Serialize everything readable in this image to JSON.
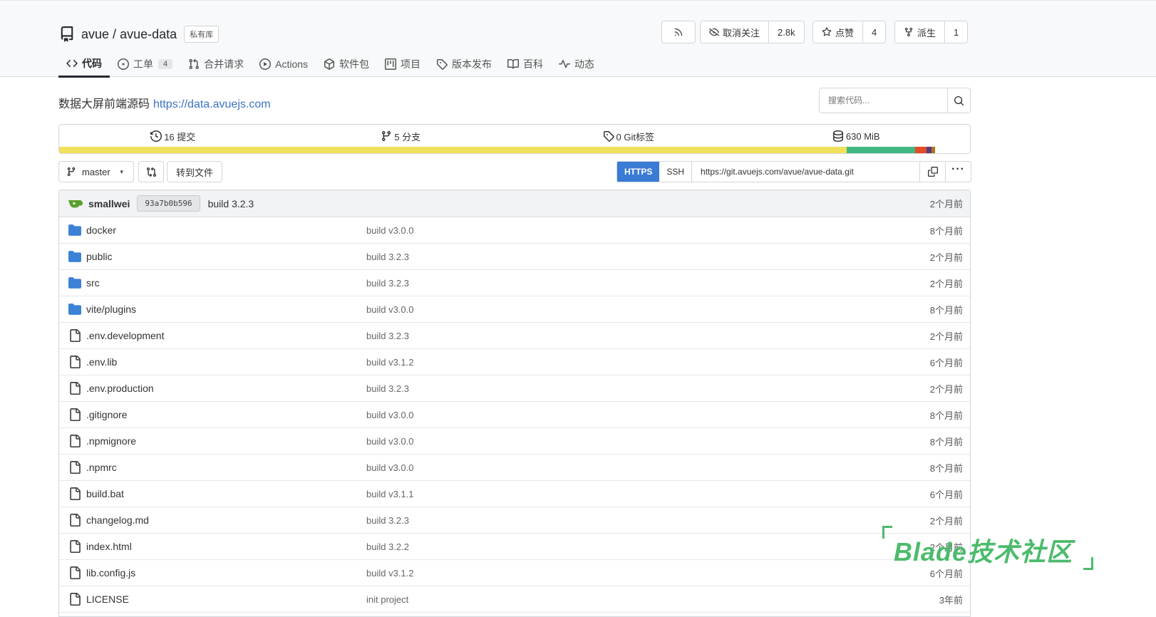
{
  "repo": {
    "owner": "avue",
    "separator": "/",
    "name": "avue-data",
    "visibility_badge": "私有库"
  },
  "actions": {
    "rss_icon": "rss-icon",
    "watch_label": "取消关注",
    "watch_count": "2.8k",
    "star_label": "点赞",
    "star_count": "4",
    "fork_label": "派生",
    "fork_count": "1"
  },
  "tabs": [
    {
      "label": "代码",
      "icon": "code-icon",
      "active": true
    },
    {
      "label": "工单",
      "icon": "issue-icon",
      "count": "4"
    },
    {
      "label": "合并请求",
      "icon": "pull-request-icon"
    },
    {
      "label": "Actions",
      "icon": "play-icon"
    },
    {
      "label": "软件包",
      "icon": "package-icon"
    },
    {
      "label": "项目",
      "icon": "project-icon"
    },
    {
      "label": "版本发布",
      "icon": "tag-icon"
    },
    {
      "label": "百科",
      "icon": "book-icon"
    },
    {
      "label": "动态",
      "icon": "pulse-icon"
    }
  ],
  "description": {
    "text": "数据大屏前端源码",
    "link": "https://data.avuejs.com"
  },
  "search": {
    "placeholder": "搜索代码..."
  },
  "stats": [
    {
      "label": "16 提交",
      "icon": "history-icon"
    },
    {
      "label": "5 分支",
      "icon": "branch-icon"
    },
    {
      "label": "0 Git标签",
      "icon": "tag-icon"
    },
    {
      "label": "630 MiB",
      "icon": "database-icon"
    }
  ],
  "language_colors": [
    "#f1e05a",
    "#41b883",
    "#e34c26",
    "#563d7c",
    "#b07219"
  ],
  "toolbar": {
    "branch": "master",
    "goto_file": "转到文件",
    "protocol_https": "HTTPS",
    "protocol_ssh": "SSH",
    "clone_url": "https://git.avuejs.com/avue/avue-data.git"
  },
  "latest_commit": {
    "author": "smallwei",
    "sha": "93a7b0b596",
    "message": "build 3.2.3",
    "time": "2个月前"
  },
  "files": [
    {
      "name": "docker",
      "type": "dir",
      "commit": "build v3.0.0",
      "time": "8个月前"
    },
    {
      "name": "public",
      "type": "dir",
      "commit": "build 3.2.3",
      "time": "2个月前"
    },
    {
      "name": "src",
      "type": "dir",
      "commit": "build 3.2.3",
      "time": "2个月前"
    },
    {
      "name": "vite/plugins",
      "type": "dir",
      "commit": "build v3.0.0",
      "time": "8个月前"
    },
    {
      "name": ".env.development",
      "type": "file",
      "commit": "build 3.2.3",
      "time": "2个月前"
    },
    {
      "name": ".env.lib",
      "type": "file",
      "commit": "build v3.1.2",
      "time": "6个月前"
    },
    {
      "name": ".env.production",
      "type": "file",
      "commit": "build 3.2.3",
      "time": "2个月前"
    },
    {
      "name": ".gitignore",
      "type": "file",
      "commit": "build v3.0.0",
      "time": "8个月前"
    },
    {
      "name": ".npmignore",
      "type": "file",
      "commit": "build v3.0.0",
      "time": "8个月前"
    },
    {
      "name": ".npmrc",
      "type": "file",
      "commit": "build v3.0.0",
      "time": "8个月前"
    },
    {
      "name": "build.bat",
      "type": "file",
      "commit": "build v3.1.1",
      "time": "6个月前"
    },
    {
      "name": "changelog.md",
      "type": "file",
      "commit": "build 3.2.3",
      "time": "2个月前"
    },
    {
      "name": "index.html",
      "type": "file",
      "commit": "build 3.2.2",
      "time": "2个月前"
    },
    {
      "name": "lib.config.js",
      "type": "file",
      "commit": "build v3.1.2",
      "time": "6个月前"
    },
    {
      "name": "LICENSE",
      "type": "file",
      "commit": "init project",
      "time": "3年前"
    }
  ],
  "watermark": "Blade技术社区"
}
